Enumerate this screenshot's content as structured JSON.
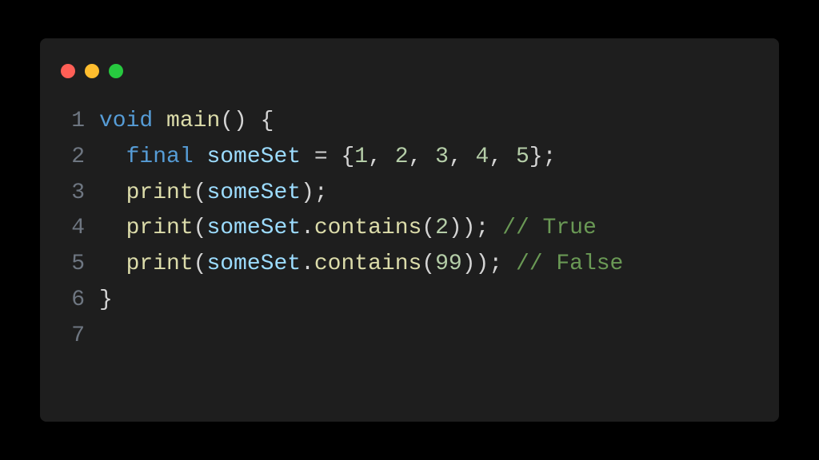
{
  "window": {
    "dots": [
      "#ff5f56",
      "#ffbd2e",
      "#27c93f"
    ]
  },
  "code": {
    "lines": [
      {
        "n": "1",
        "tokens": [
          {
            "t": "void",
            "c": "k-type"
          },
          {
            "t": " ",
            "c": "k-punc"
          },
          {
            "t": "main",
            "c": "k-func"
          },
          {
            "t": "() {",
            "c": "k-punc"
          }
        ]
      },
      {
        "n": "2",
        "tokens": [
          {
            "t": "  ",
            "c": "k-punc"
          },
          {
            "t": "final",
            "c": "k-type"
          },
          {
            "t": " ",
            "c": "k-punc"
          },
          {
            "t": "someSet",
            "c": "k-var"
          },
          {
            "t": " = {",
            "c": "k-punc"
          },
          {
            "t": "1",
            "c": "k-num"
          },
          {
            "t": ", ",
            "c": "k-punc"
          },
          {
            "t": "2",
            "c": "k-num"
          },
          {
            "t": ", ",
            "c": "k-punc"
          },
          {
            "t": "3",
            "c": "k-num"
          },
          {
            "t": ", ",
            "c": "k-punc"
          },
          {
            "t": "4",
            "c": "k-num"
          },
          {
            "t": ", ",
            "c": "k-punc"
          },
          {
            "t": "5",
            "c": "k-num"
          },
          {
            "t": "};",
            "c": "k-punc"
          }
        ]
      },
      {
        "n": "3",
        "tokens": [
          {
            "t": "  ",
            "c": "k-punc"
          },
          {
            "t": "print",
            "c": "k-func"
          },
          {
            "t": "(",
            "c": "k-punc"
          },
          {
            "t": "someSet",
            "c": "k-var"
          },
          {
            "t": ");",
            "c": "k-punc"
          }
        ]
      },
      {
        "n": "4",
        "tokens": [
          {
            "t": "  ",
            "c": "k-punc"
          },
          {
            "t": "print",
            "c": "k-func"
          },
          {
            "t": "(",
            "c": "k-punc"
          },
          {
            "t": "someSet",
            "c": "k-var"
          },
          {
            "t": ".",
            "c": "k-punc"
          },
          {
            "t": "contains",
            "c": "k-func"
          },
          {
            "t": "(",
            "c": "k-punc"
          },
          {
            "t": "2",
            "c": "k-num"
          },
          {
            "t": ")); ",
            "c": "k-punc"
          },
          {
            "t": "// True",
            "c": "k-comment"
          }
        ]
      },
      {
        "n": "5",
        "tokens": [
          {
            "t": "  ",
            "c": "k-punc"
          },
          {
            "t": "print",
            "c": "k-func"
          },
          {
            "t": "(",
            "c": "k-punc"
          },
          {
            "t": "someSet",
            "c": "k-var"
          },
          {
            "t": ".",
            "c": "k-punc"
          },
          {
            "t": "contains",
            "c": "k-func"
          },
          {
            "t": "(",
            "c": "k-punc"
          },
          {
            "t": "99",
            "c": "k-num"
          },
          {
            "t": ")); ",
            "c": "k-punc"
          },
          {
            "t": "// False",
            "c": "k-comment"
          }
        ]
      },
      {
        "n": "6",
        "tokens": [
          {
            "t": "}",
            "c": "k-punc"
          }
        ]
      },
      {
        "n": "7",
        "tokens": []
      }
    ]
  }
}
